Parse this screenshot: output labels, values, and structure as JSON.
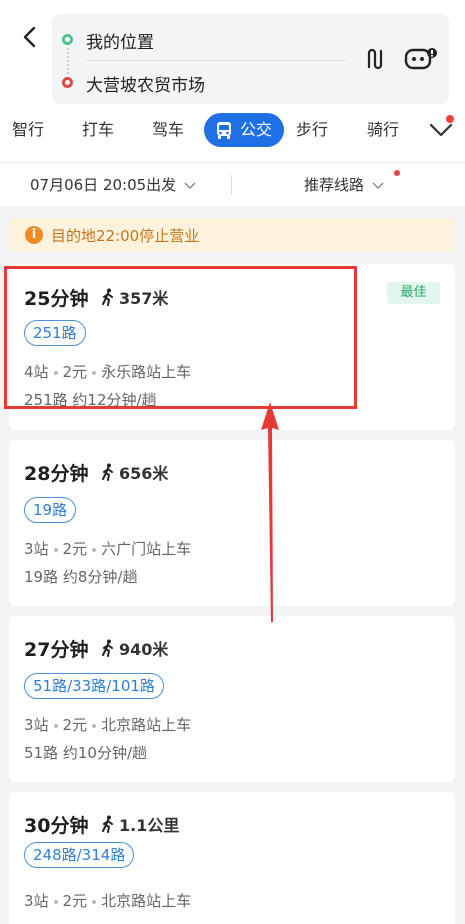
{
  "header": {
    "start": "我的位置",
    "end": "大营坡农贸市场"
  },
  "tabs": [
    {
      "label": "智行"
    },
    {
      "label": "打车"
    },
    {
      "label": "驾车"
    },
    {
      "label": "公交",
      "active": true
    },
    {
      "label": "步行"
    },
    {
      "label": "骑行"
    }
  ],
  "options": {
    "time": "07月06日 20:05出发",
    "route_pref": "推荐线路"
  },
  "notice": {
    "text": "目的地22:00停止营业"
  },
  "routes": [
    {
      "time": "25分钟",
      "walk": "357米",
      "badge": "最佳",
      "line_tag": "251路",
      "stops": "4站",
      "price": "2元",
      "board": "永乐路站上车",
      "frequency": "251路 约12分钟/趟"
    },
    {
      "time": "28分钟",
      "walk": "656米",
      "line_tag": "19路",
      "stops": "3站",
      "price": "2元",
      "board": "六广门站上车",
      "frequency": "19路 约8分钟/趟"
    },
    {
      "time": "27分钟",
      "walk": "940米",
      "line_tag": "51路/33路/101路",
      "stops": "3站",
      "price": "2元",
      "board": "北京路站上车",
      "frequency": "51路 约10分钟/趟"
    },
    {
      "time": "30分钟",
      "walk": "1.1公里",
      "line_tag": "248路/314路",
      "stops": "3站",
      "price": "2元",
      "board": "北京路站上车"
    }
  ],
  "colors": {
    "accent": "#1f6fe5",
    "annotation": "#e53935"
  }
}
